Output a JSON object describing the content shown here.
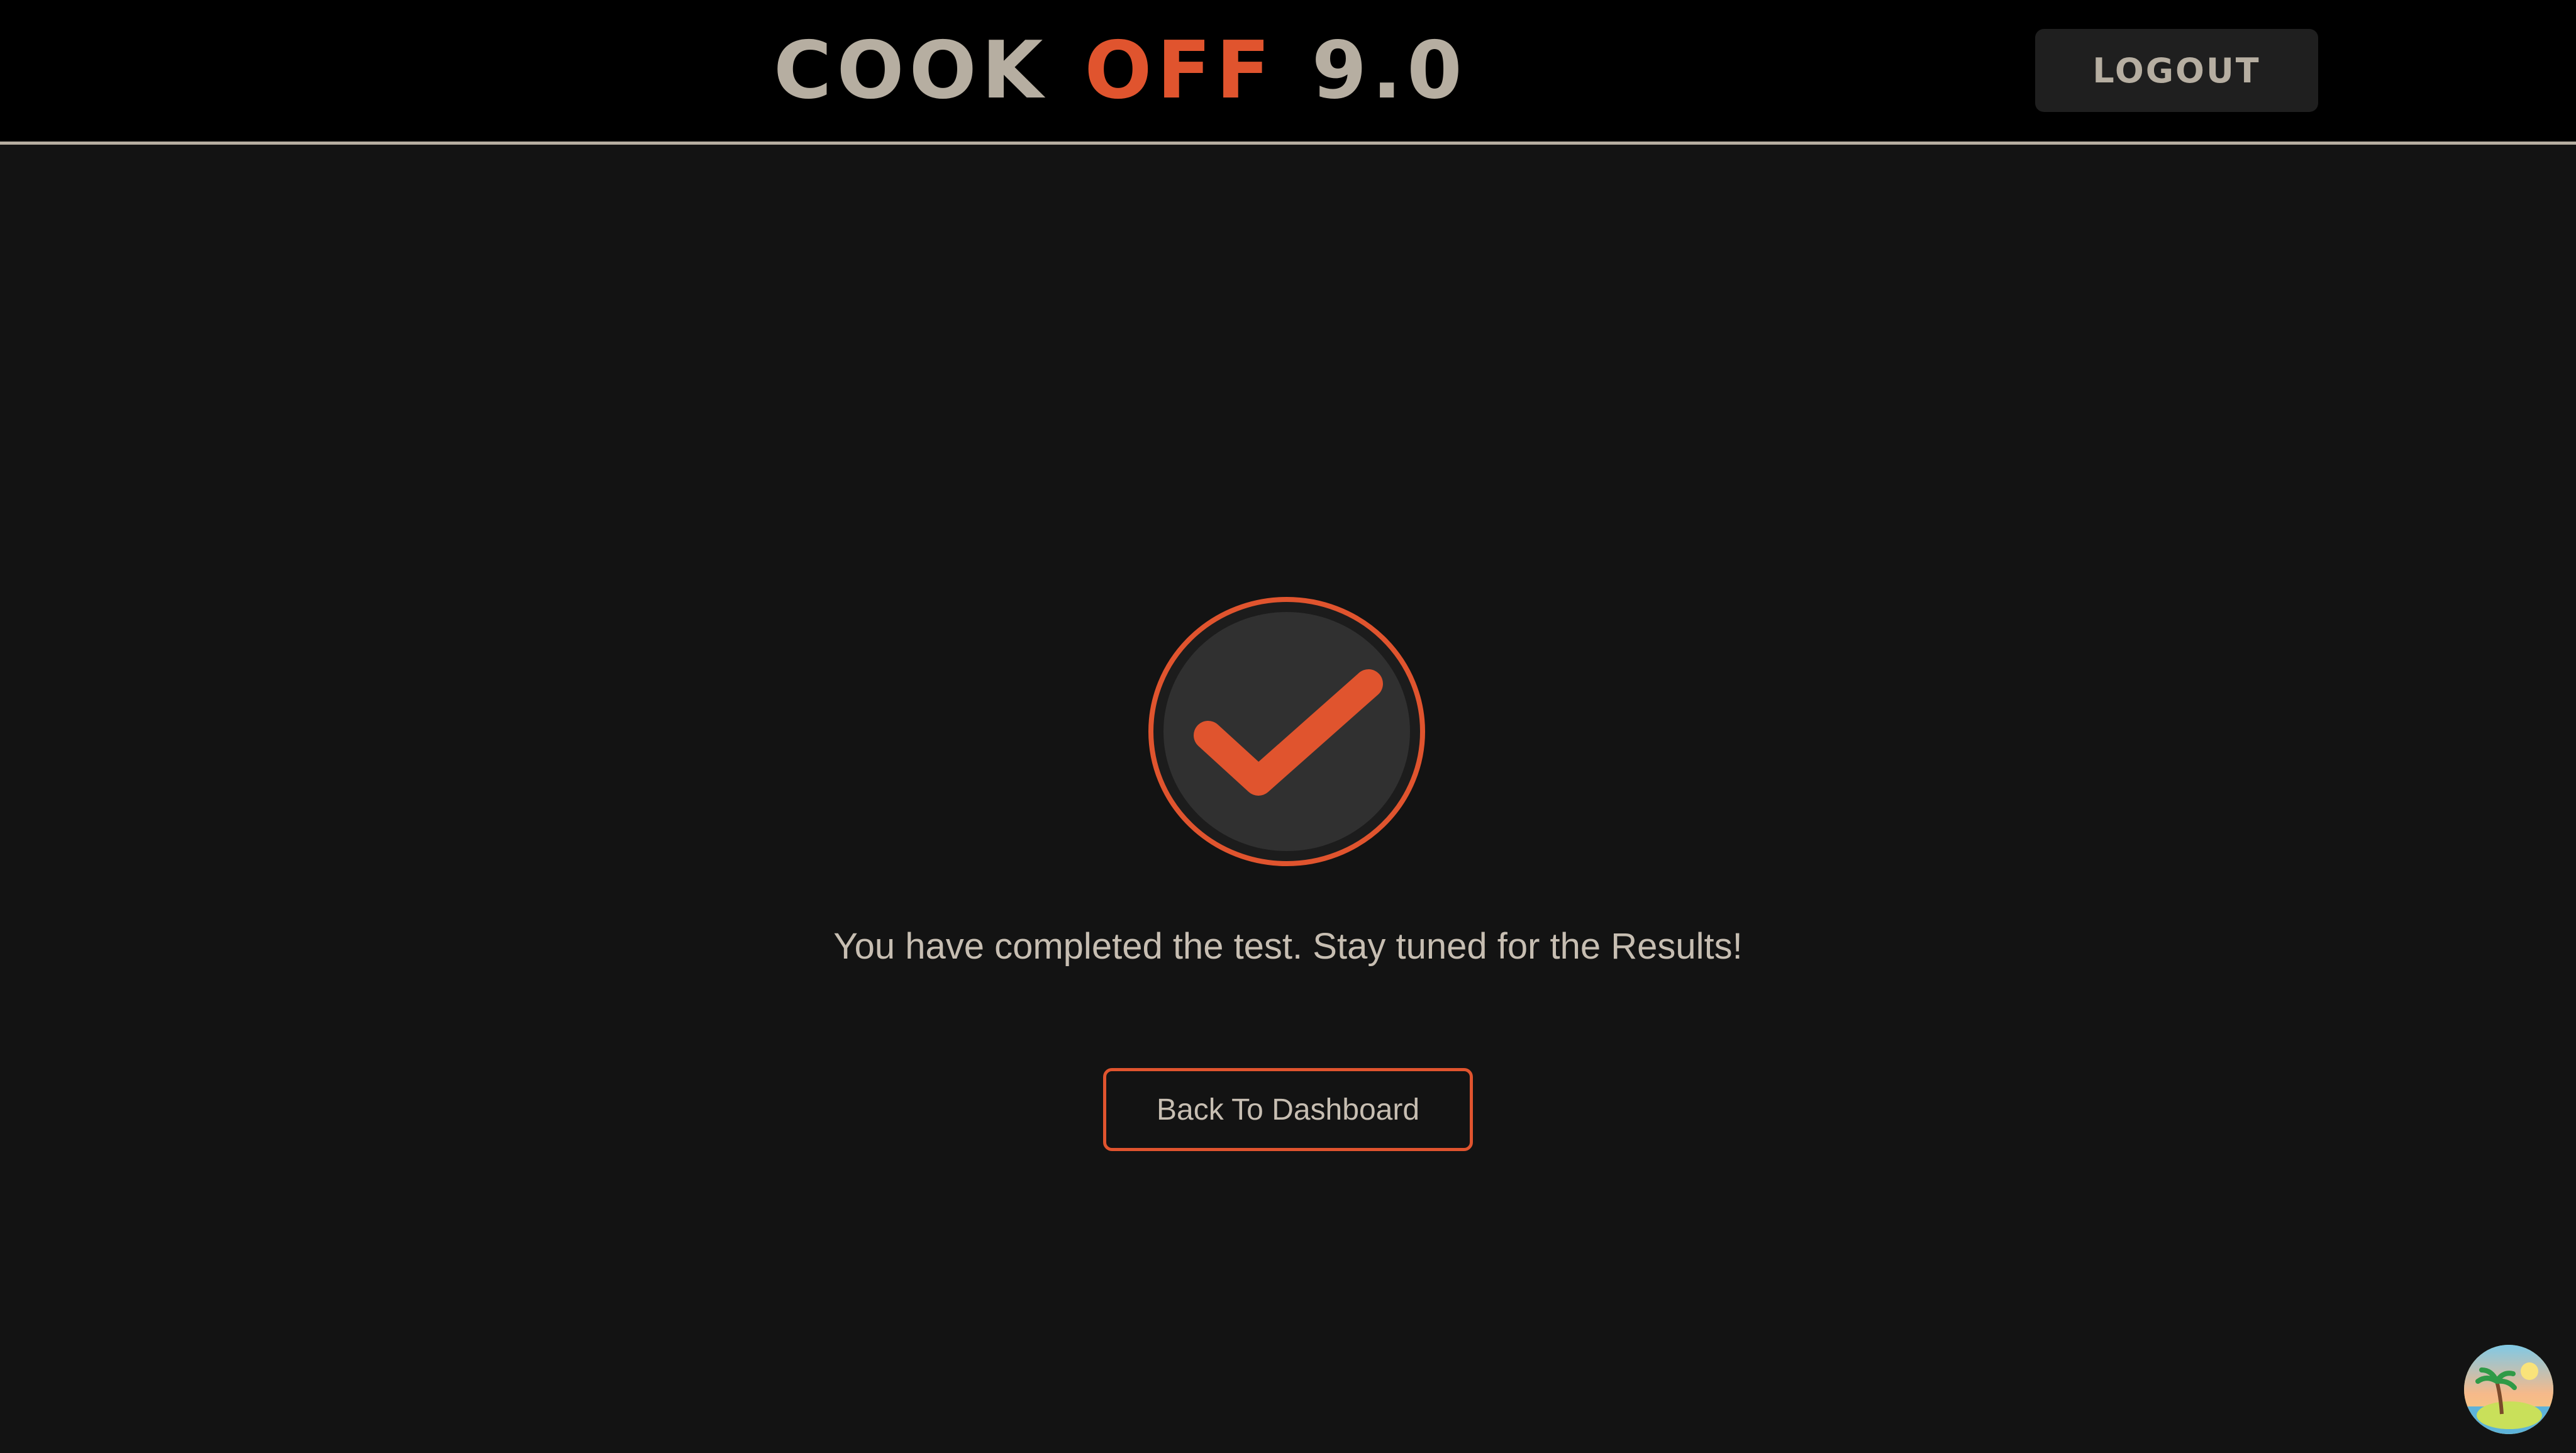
{
  "header": {
    "brand_words": [
      "COOK",
      "OFF",
      "9.0"
    ],
    "logout_label": "LOGOUT"
  },
  "main": {
    "status_icon": "check-circle-icon",
    "message": "You have completed the test. Stay tuned for the Results!",
    "back_button_label": "Back To Dashboard"
  },
  "corner_widget": {
    "icon": "palm-island-avatar-icon"
  },
  "colors": {
    "background": "#131313",
    "header_bg": "#000000",
    "accent": "#e0542e",
    "text": "#c7beb2",
    "brand_neutral": "#b6aea1",
    "button_dark": "#1f1f1f"
  }
}
